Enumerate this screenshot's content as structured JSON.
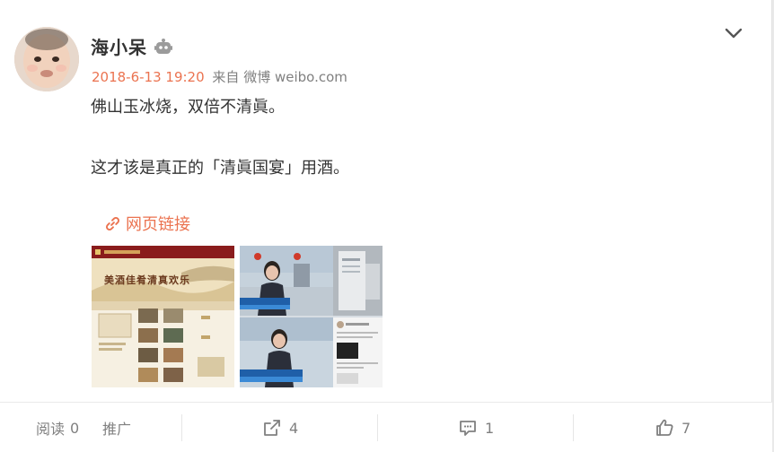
{
  "post": {
    "username": "海小呆",
    "timestamp": "2018-6-13 19:20",
    "source_prefix": "来自",
    "source": "微博 weibo.com",
    "lines": [
      "佛山玉冰烧，双倍不清眞。",
      "这才该是真正的「清眞国宴」用酒。"
    ],
    "weblink_label": "网页链接"
  },
  "icons": {
    "badge": "robot-badge-icon",
    "menu": "chevron-down-icon",
    "link": "link-icon",
    "forward": "share-icon",
    "comment": "comment-icon",
    "like": "thumbs-up-icon"
  },
  "images": {
    "thumb1_banner": "美酒佳肴清真欢乐"
  },
  "footer": {
    "read_label": "阅读",
    "read_count": "0",
    "promote_label": "推广",
    "forward_count": "4",
    "comment_count": "1",
    "like_count": "7"
  },
  "colors": {
    "accent": "#eb7350",
    "muted": "#808080",
    "text": "#333333"
  }
}
